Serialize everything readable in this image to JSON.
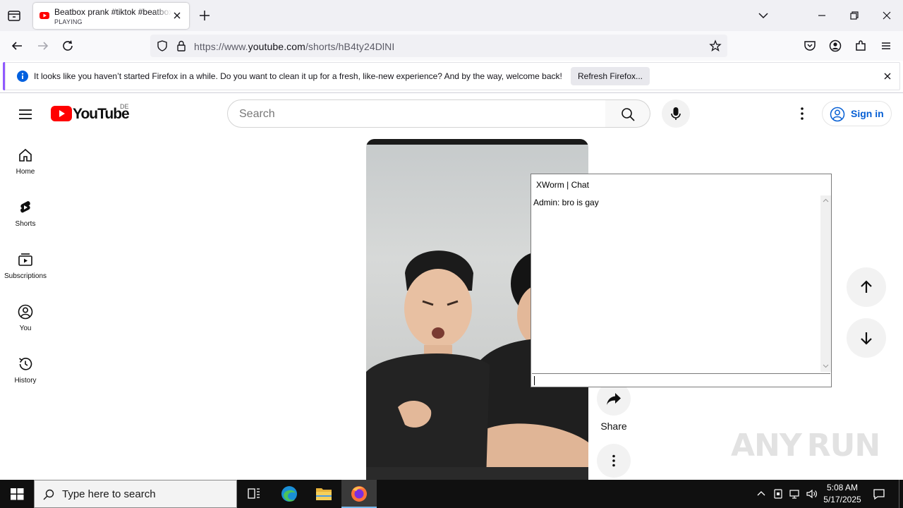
{
  "browser": {
    "tab": {
      "title": "Beatbox prank #tiktok #beatbox",
      "status": "PLAYING"
    },
    "url": {
      "prefix": "https://www.",
      "domain": "youtube.com",
      "path": "/shorts/hB4ty24DlNI"
    },
    "notification": {
      "message": "It looks like you haven’t started Firefox in a while. Do you want to clean it up for a fresh, like-new experience? And by the way, welcome back!",
      "button_label": "Refresh Firefox..."
    }
  },
  "youtube": {
    "logo_text": "YouTube",
    "country_code": "DE",
    "search_placeholder": "Search",
    "sign_in_label": "Sign in",
    "guide": [
      {
        "label": "Home",
        "icon": "home-icon"
      },
      {
        "label": "Shorts",
        "icon": "shorts-icon"
      },
      {
        "label": "Subscriptions",
        "icon": "subscriptions-icon"
      },
      {
        "label": "You",
        "icon": "you-icon"
      },
      {
        "label": "History",
        "icon": "history-icon"
      }
    ],
    "share_label": "Share",
    "accent": "#ff0000",
    "link_blue": "#065fd4"
  },
  "chat_window": {
    "title": "XWorm | Chat",
    "messages": [
      "Admin: bro is gay"
    ],
    "input_value": ""
  },
  "watermark": "ANY RUN",
  "taskbar": {
    "search_placeholder": "Type here to search",
    "time": "5:08 AM",
    "date": "5/17/2025"
  }
}
